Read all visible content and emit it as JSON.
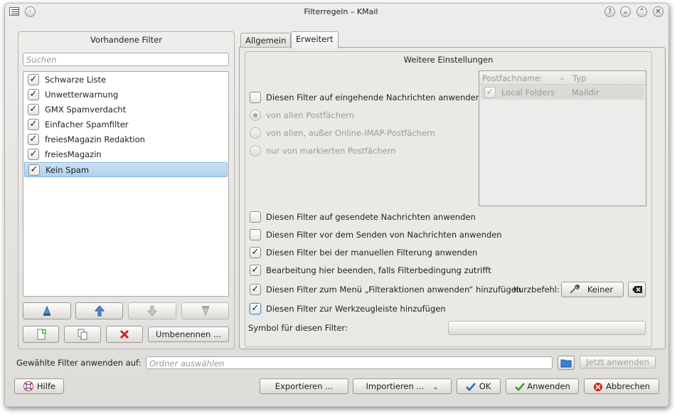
{
  "window": {
    "title": "Filterregeln – KMail"
  },
  "titlebar_buttons": [
    "?",
    "⌄",
    "⌃",
    "✕"
  ],
  "left_panel": {
    "title": "Vorhandene Filter",
    "search_placeholder": "Suchen",
    "filters": [
      {
        "label": "Schwarze Liste",
        "checked": true
      },
      {
        "label": "Unwetterwarnung",
        "checked": true
      },
      {
        "label": "GMX Spamverdacht",
        "checked": true
      },
      {
        "label": "Einfacher Spamfilter",
        "checked": true
      },
      {
        "label": "freiesMagazin Redaktion",
        "checked": true
      },
      {
        "label": "freiesMagazin",
        "checked": true
      },
      {
        "label": "Kein Spam",
        "checked": true,
        "selected": true
      }
    ],
    "rename_label": "Umbenennen ..."
  },
  "tabs": [
    {
      "label": "Allgemein",
      "active": false
    },
    {
      "label": "Erweitert",
      "active": true
    }
  ],
  "advanced": {
    "group_title": "Weitere Einstellungen",
    "incoming_label": "Diesen Filter auf eingehende Nachrichten anwenden",
    "radio_all": "von allen Postfächern",
    "radio_except_imap": "von allen, außer Online-IMAP-Postfächern",
    "radio_marked": "nur von markierten Postfächern",
    "tree": {
      "col_name": "Postfachname:",
      "col_type": "Typ",
      "rows": [
        {
          "name": "Local Folders",
          "type": "Maildir",
          "checked": true
        }
      ]
    },
    "sent_label": "Diesen Filter auf gesendete Nachrichten anwenden",
    "before_send_label": "Diesen Filter vor dem Senden von Nachrichten anwenden",
    "manual_label": "Diesen Filter bei der manuellen Filterung anwenden",
    "stop_label": "Bearbeitung hier beenden, falls Filterbedingung zutrifft",
    "menu_label": "Diesen Filter zum Menü „Filteraktionen anwenden“ hinzufügen",
    "shortcut_label": "Kurzbefehl:",
    "shortcut_value": "Keiner",
    "toolbar_label": "Diesen Filter zur Werkzeugleiste hinzufügen",
    "symbol_label": "Symbol für diesen Filter:"
  },
  "apply_row": {
    "label": "Gewählte Filter anwenden auf:",
    "folder_placeholder": "Ordner auswählen",
    "apply_now": "Jetzt anwenden"
  },
  "footer": {
    "help": "Hilfe",
    "export": "Exportieren ...",
    "import": "Importieren ...",
    "ok": "OK",
    "apply": "Anwenden",
    "cancel": "Abbrechen"
  },
  "colors": {
    "selection": "#aed0ee",
    "cancel_red": "#d42020",
    "ok_blue": "#2a62b8",
    "apply_green": "#3c9a2c"
  }
}
